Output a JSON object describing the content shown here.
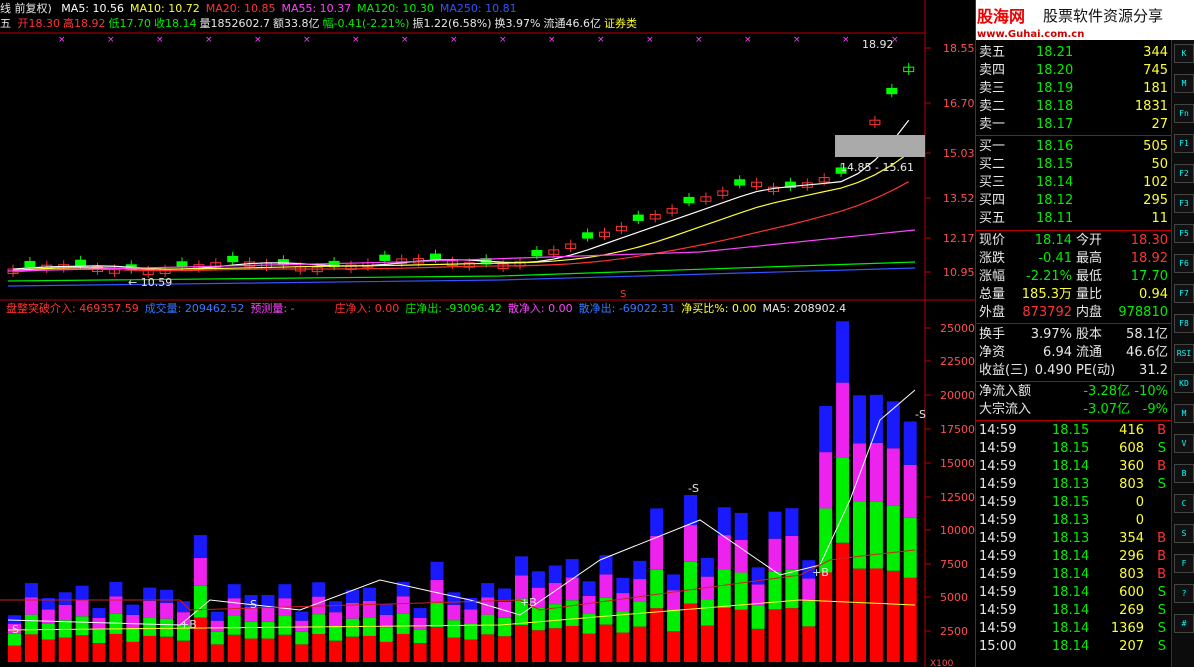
{
  "window": {
    "title_fragment": "线 前复权)"
  },
  "price_header": {
    "ma_items": [
      {
        "label": "MA5: 10.56",
        "color": "#ffffff"
      },
      {
        "label": "MA10: 10.72",
        "color": "#ffff33"
      },
      {
        "label": "MA20: 10.85",
        "color": "#ff3333"
      },
      {
        "label": "MA55: 10.37",
        "color": "#ff44ff"
      },
      {
        "label": "MA120: 10.30",
        "color": "#00ee00"
      },
      {
        "label": "MA250: 10.81",
        "color": "#3355ff"
      }
    ],
    "day_prefix": "五",
    "ohlc": [
      {
        "label": "开18.30",
        "color": "#ff3333"
      },
      {
        "label": "高18.92",
        "color": "#ff3333"
      },
      {
        "label": "低17.70",
        "color": "#00ee00"
      },
      {
        "label": "收18.14",
        "color": "#00ee00"
      },
      {
        "label": "量1852602.7",
        "color": "#e8e8e8"
      },
      {
        "label": "额33.8亿",
        "color": "#e8e8e8"
      },
      {
        "label": "幅-0.41(-2.21%)",
        "color": "#00ee00"
      },
      {
        "label": "振1.22(6.58%)",
        "color": "#e8e8e8"
      },
      {
        "label": "换3.97%",
        "color": "#e8e8e8"
      },
      {
        "label": "流通46.6亿",
        "color": "#e8e8e8"
      },
      {
        "label": "证券类",
        "color": "#ffff33"
      }
    ]
  },
  "price_axis": [
    "18.55",
    "16.70",
    "15.03",
    "13.52",
    "12.17",
    "10.95"
  ],
  "price_annotations": {
    "high_label": "18.92",
    "low_label": "10.59",
    "zone_label": "14.85 - 15.61",
    "signal_s": "S"
  },
  "volume_header": [
    {
      "label": "盘整突破介入: 469357.59",
      "color": "#ff3333"
    },
    {
      "label": "成交量: 209462.52",
      "color": "#3377ff"
    },
    {
      "label": "预测量: -",
      "color": "#ff44ff"
    },
    {
      "label": "庄净入: 0.00",
      "color": "#ff3333"
    },
    {
      "label": "庄净出: -93096.42",
      "color": "#00ee00"
    },
    {
      "label": "散净入: 0.00",
      "color": "#ff44ff"
    },
    {
      "label": "散净出: -69022.31",
      "color": "#3377ff"
    },
    {
      "label": "净买比%: 0.00",
      "color": "#ffff33"
    },
    {
      "label": "MA5: 208902.4",
      "color": "#e8e8e8"
    }
  ],
  "volume_axis": [
    "25000",
    "22500",
    "20000",
    "17500",
    "15000",
    "12500",
    "10000",
    "7500",
    "5000",
    "2500"
  ],
  "volume_markers": {
    "s": "S",
    "b": "B",
    "plus_b": "+B",
    "minus_s": "-S",
    "unit": "X100"
  },
  "logo": {
    "brand": "股海网",
    "slogan": "股票软件资源分享",
    "url": "www.Guhai.com.cn"
  },
  "quote": {
    "sell": [
      {
        "label": "卖五",
        "price": "18.21",
        "vol": "344"
      },
      {
        "label": "卖四",
        "price": "18.20",
        "vol": "745"
      },
      {
        "label": "卖三",
        "price": "18.19",
        "vol": "181"
      },
      {
        "label": "卖二",
        "price": "18.18",
        "vol": "1831"
      },
      {
        "label": "卖一",
        "price": "18.17",
        "vol": "27"
      }
    ],
    "buy": [
      {
        "label": "买一",
        "price": "18.16",
        "vol": "505"
      },
      {
        "label": "买二",
        "price": "18.15",
        "vol": "50"
      },
      {
        "label": "买三",
        "price": "18.14",
        "vol": "102"
      },
      {
        "label": "买四",
        "price": "18.12",
        "vol": "295"
      },
      {
        "label": "买五",
        "price": "18.11",
        "vol": "11"
      }
    ],
    "stats": [
      {
        "l1": "现价",
        "v1": "18.14",
        "c1": "#00ee00",
        "l2": "今开",
        "v2": "18.30",
        "c2": "#ff3333"
      },
      {
        "l1": "涨跌",
        "v1": "-0.41",
        "c1": "#00ee00",
        "l2": "最高",
        "v2": "18.92",
        "c2": "#ff3333"
      },
      {
        "l1": "涨幅",
        "v1": "-2.21%",
        "c1": "#00ee00",
        "l2": "最低",
        "v2": "17.70",
        "c2": "#00ee00"
      },
      {
        "l1": "总量",
        "v1": "185.3万",
        "c1": "#ffff33",
        "l2": "量比",
        "v2": "0.94",
        "c2": "#ffff33"
      },
      {
        "l1": "外盘",
        "v1": "873792",
        "c1": "#ff3333",
        "l2": "内盘",
        "v2": "978810",
        "c2": "#00ee00"
      }
    ],
    "fund": [
      {
        "l1": "换手",
        "v1": "3.97%",
        "l2": "股本",
        "v2": "58.1亿"
      },
      {
        "l1": "净资",
        "v1": "6.94",
        "l2": "流通",
        "v2": "46.6亿"
      },
      {
        "l1": "收益(三)",
        "v1": "0.490",
        "l2": "PE(动)",
        "v2": "31.2"
      }
    ],
    "flow": [
      {
        "label": "净流入额",
        "val": "-3.28亿",
        "pct": "-10%"
      },
      {
        "label": "大宗流入",
        "val": "-3.07亿",
        "pct": "-9%"
      }
    ],
    "ticks": [
      {
        "time": "14:59",
        "price": "18.15",
        "vol": "416",
        "side": "B"
      },
      {
        "time": "14:59",
        "price": "18.15",
        "vol": "608",
        "side": "S"
      },
      {
        "time": "14:59",
        "price": "18.14",
        "vol": "360",
        "side": "B"
      },
      {
        "time": "14:59",
        "price": "18.13",
        "vol": "803",
        "side": "S"
      },
      {
        "time": "14:59",
        "price": "18.15",
        "vol": "0",
        "side": ""
      },
      {
        "time": "14:59",
        "price": "18.13",
        "vol": "0",
        "side": ""
      },
      {
        "time": "14:59",
        "price": "18.13",
        "vol": "354",
        "side": "B"
      },
      {
        "time": "14:59",
        "price": "18.14",
        "vol": "296",
        "side": "B"
      },
      {
        "time": "14:59",
        "price": "18.14",
        "vol": "803",
        "side": "B"
      },
      {
        "time": "14:59",
        "price": "18.14",
        "vol": "600",
        "side": "S"
      },
      {
        "time": "14:59",
        "price": "18.14",
        "vol": "269",
        "side": "S"
      },
      {
        "time": "14:59",
        "price": "18.14",
        "vol": "1369",
        "side": "S"
      },
      {
        "time": "15:00",
        "price": "18.14",
        "vol": "207",
        "side": "S"
      }
    ]
  },
  "toolbar": [
    "K",
    "M",
    "Fn",
    "F1",
    "F2",
    "F3",
    "F5",
    "F6",
    "F7",
    "F8",
    "RSI",
    "KD",
    "M",
    "V",
    "B",
    "C",
    "S",
    "F",
    "?",
    "#"
  ]
}
